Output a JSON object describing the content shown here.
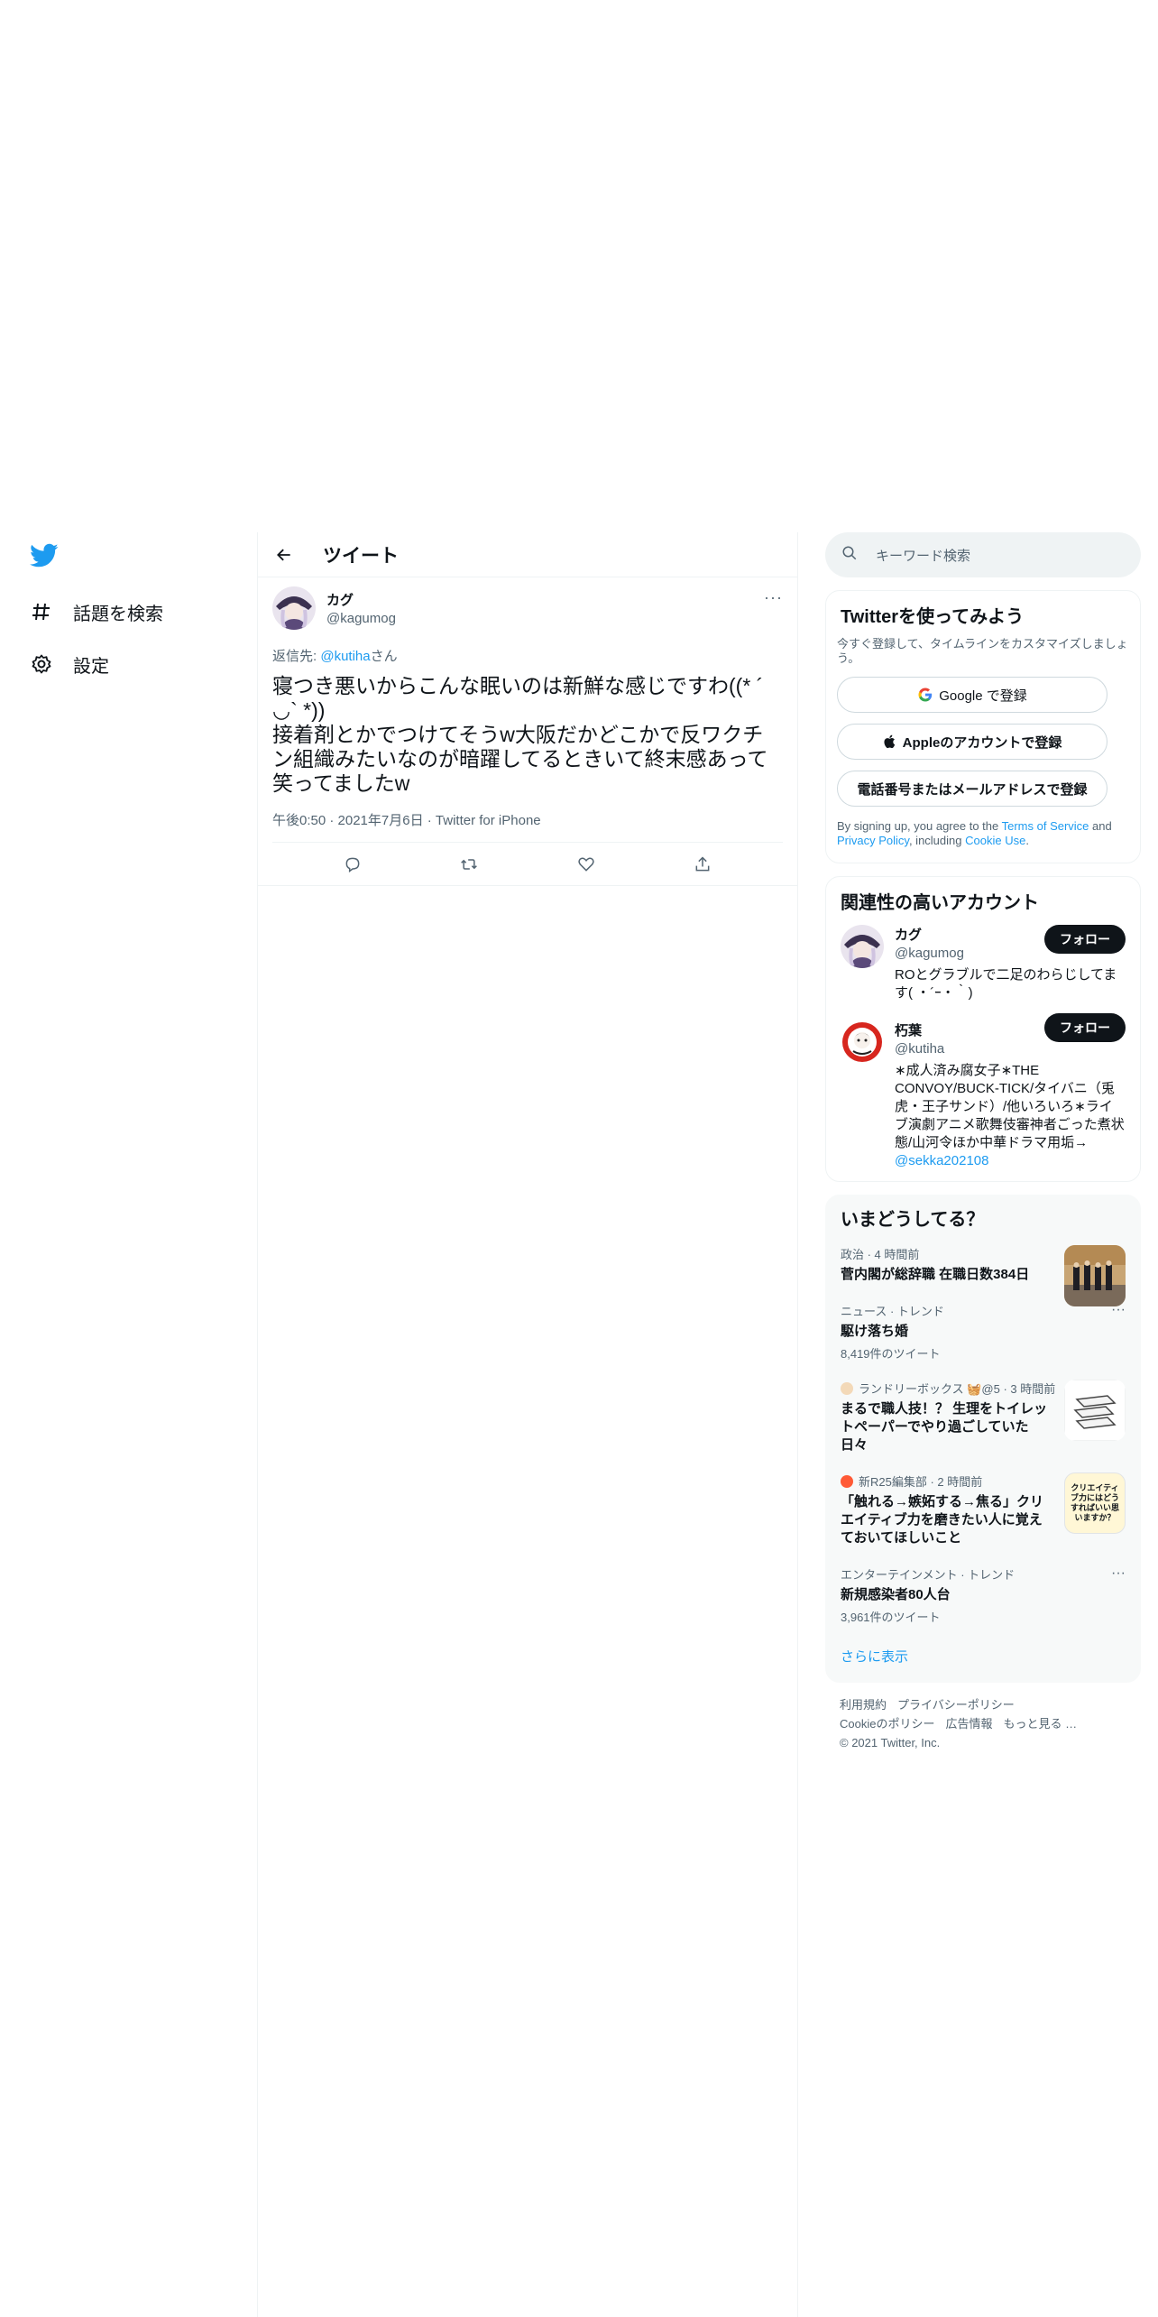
{
  "nav": {
    "explore_label": "話題を検索",
    "settings_label": "設定"
  },
  "header": {
    "title": "ツイート"
  },
  "tweet": {
    "author_name": "カグ",
    "author_handle": "@kagumog",
    "reply_prefix": "返信先: ",
    "reply_mention": "@kutiha",
    "reply_suffix": "さん",
    "text": "寝つき悪いからこんな眠いのは新鮮な感じですわ((* ´ ◡` *))\n接着剤とかでつけてそうw大阪だかどこかで反ワクチン組織みたいなのが暗躍してるときいて終末感あって笑ってましたw",
    "meta": "午後0:50 · 2021年7月6日 · Twitter for iPhone"
  },
  "search": {
    "placeholder": "キーワード検索"
  },
  "signup": {
    "title": "Twitterを使ってみよう",
    "subtitle": "今すぐ登録して、タイムラインをカスタマイズしましょう。",
    "google_label": "Google で登録",
    "apple_label": "Appleのアカウントで登録",
    "phone_label": "電話番号またはメールアドレスで登録",
    "legal_prefix": "By signing up, you agree to the ",
    "terms": "Terms of Service",
    "legal_and": " and ",
    "privacy": "Privacy Policy",
    "legal_including": ", including ",
    "cookie": "Cookie Use",
    "legal_end": "."
  },
  "related": {
    "title": "関連性の高いアカウント",
    "follow_label": "フォロー",
    "accounts": [
      {
        "name": "カグ",
        "handle": "@kagumog",
        "bio": "ROとグラブルで二足のわらじしてます( ・´ｰ・｀)"
      },
      {
        "name": "朽葉",
        "handle": "@kutiha",
        "bio": "∗成人済み腐女子∗THE CONVOY/BUCK-TICK/タイバニ（兎虎・王子サンド）/他いろいろ∗ライブ演劇アニメ歌舞伎審神者ごった煮状態/山河令ほか中華ドラマ用垢→",
        "bio_link": "@sekka202108"
      }
    ]
  },
  "trends": {
    "title": "いまどうしてる？",
    "items": [
      {
        "context": "政治 · 4 時間前",
        "title": "菅内閣が総辞職 在職日数384日",
        "count": ""
      },
      {
        "context": "ニュース · トレンド",
        "title": "駆け落ち婚",
        "count": "8,419件のツイート"
      },
      {
        "context": "ランドリーボックス 🧺@5 · 3 時間前",
        "title": "まるで職人技！？ 生理をトイレットペーパーでやり過ごしていた日々",
        "count": ""
      },
      {
        "context": "新R25編集部 · 2 時間前",
        "title": "「触れる→嫉妬する→焦る」クリエイティブ力を磨きたい人に覚えておいてほしいこと",
        "count": ""
      },
      {
        "context": "エンターテインメント · トレンド",
        "title": "新規感染者80人台",
        "count": "3,961件のツイート"
      }
    ],
    "show_more": "さらに表示",
    "thumb3_text": "クリエイティブ力にはどうすればいい思いますか？"
  },
  "footer": {
    "terms": "利用規約",
    "privacy": "プライバシーポリシー",
    "cookie": "Cookieのポリシー",
    "ads": "広告情報",
    "more": "もっと見る …",
    "copyright": "© 2021 Twitter, Inc."
  },
  "colors": {
    "accent": "#1d9bf0",
    "text": "#0f1419",
    "muted": "#536471"
  }
}
